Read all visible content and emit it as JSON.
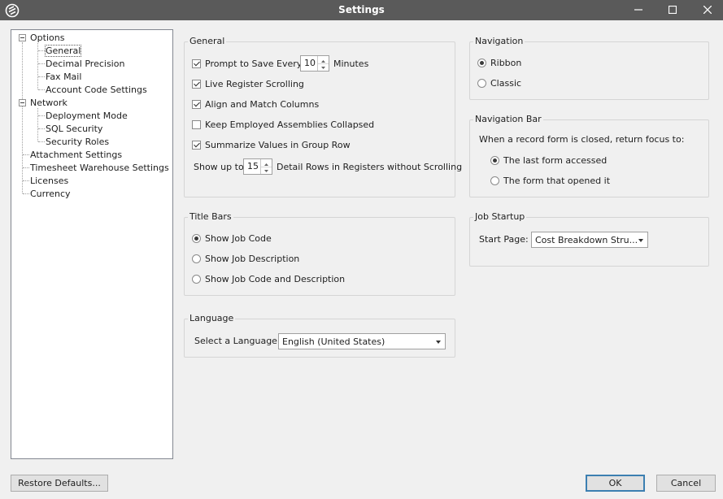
{
  "window": {
    "title": "Settings"
  },
  "tree": {
    "options": "Options",
    "general": "General",
    "decimal_precision": "Decimal Precision",
    "fax_mail": "Fax Mail",
    "account_code_settings": "Account Code Settings",
    "network": "Network",
    "deployment_mode": "Deployment Mode",
    "sql_security": "SQL Security",
    "security_roles": "Security Roles",
    "attachment_settings": "Attachment Settings",
    "timesheet_warehouse_settings": "Timesheet Warehouse Settings",
    "licenses": "Licenses",
    "currency": "Currency"
  },
  "general": {
    "title": "General",
    "prompt_save_label": "Prompt to Save Every",
    "prompt_save_value": "10",
    "minutes_label": "Minutes",
    "live_register_label": "Live Register Scrolling",
    "align_columns_label": "Align and Match Columns",
    "keep_collapsed_label": "Keep Employed Assemblies Collapsed",
    "summarize_label": "Summarize Values in Group Row",
    "show_up_to_label": "Show up to",
    "detail_rows_value": "15",
    "detail_rows_label": "Detail Rows in Registers without Scrolling"
  },
  "navigation": {
    "title": "Navigation",
    "ribbon": "Ribbon",
    "classic": "Classic"
  },
  "navigation_bar": {
    "title": "Navigation Bar",
    "prompt": "When a record form is closed, return focus to:",
    "last_form": "The last form accessed",
    "opened_form": "The form that opened it"
  },
  "title_bars": {
    "title": "Title Bars",
    "job_code": "Show Job Code",
    "job_description": "Show Job Description",
    "code_and_description": "Show Job Code and Description"
  },
  "job_startup": {
    "title": "Job Startup",
    "start_page_label": "Start Page:",
    "start_page_value": "Cost Breakdown Stru..."
  },
  "language": {
    "title": "Language",
    "select_label": "Select a Language:",
    "value": "English (United States)"
  },
  "buttons": {
    "restore": "Restore Defaults...",
    "ok": "OK",
    "cancel": "Cancel"
  }
}
